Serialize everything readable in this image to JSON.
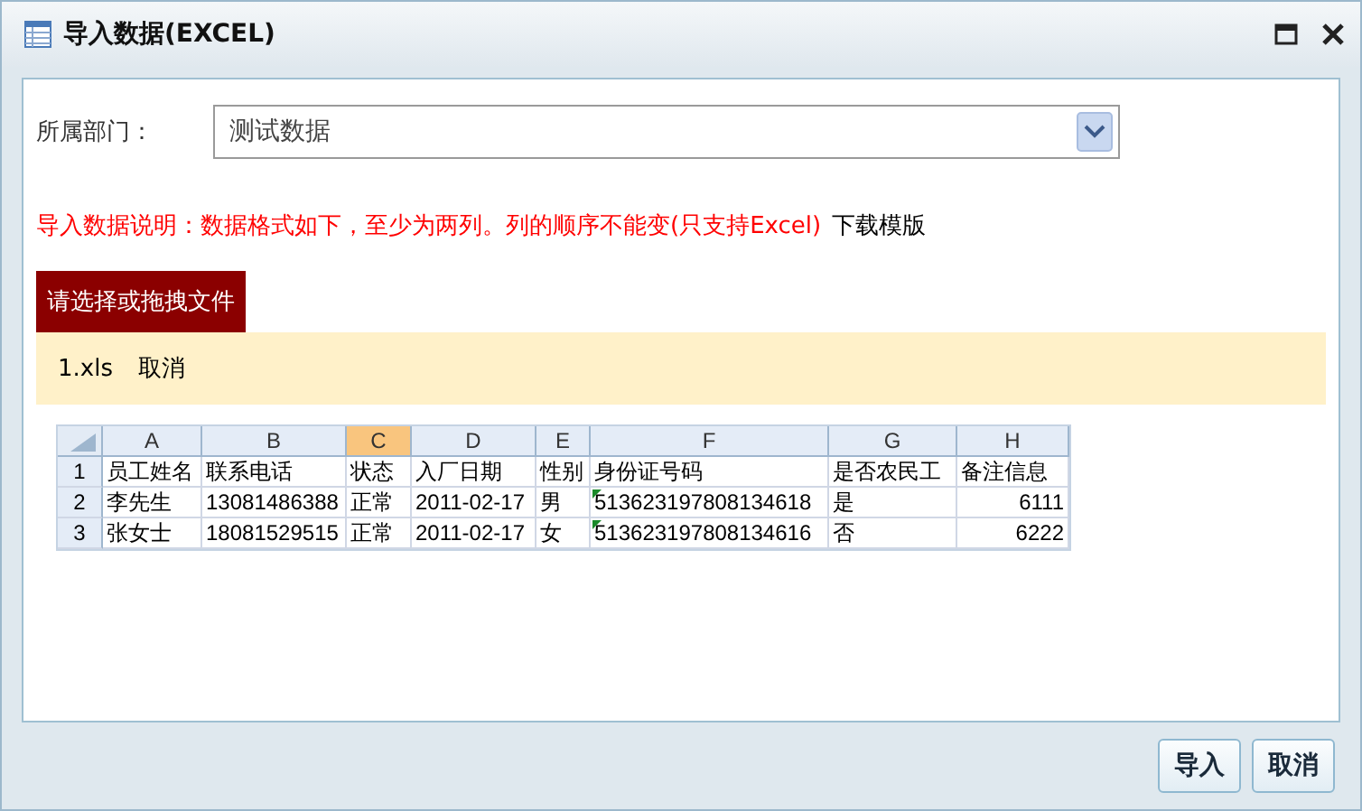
{
  "window": {
    "title": "导入数据(EXCEL)"
  },
  "department": {
    "label": "所属部门：",
    "value": "测试数据"
  },
  "notice": {
    "text": "导入数据说明：数据格式如下，至少为两列。列的顺序不能变(只支持Excel)",
    "link": "下载模版"
  },
  "upload": {
    "button": "请选择或拖拽文件",
    "file": {
      "name": "1.xls",
      "cancel": "取消"
    }
  },
  "sheet": {
    "columns": [
      {
        "letter": "A",
        "selected": false,
        "kind": "text"
      },
      {
        "letter": "B",
        "selected": false,
        "kind": "text"
      },
      {
        "letter": "C",
        "selected": true,
        "kind": "text"
      },
      {
        "letter": "D",
        "selected": false,
        "kind": "text"
      },
      {
        "letter": "E",
        "selected": false,
        "kind": "text"
      },
      {
        "letter": "F",
        "selected": false,
        "kind": "flagged"
      },
      {
        "letter": "G",
        "selected": false,
        "kind": "text"
      },
      {
        "letter": "H",
        "selected": false,
        "kind": "number"
      }
    ],
    "header": {
      "number": "1",
      "cells": [
        "员工姓名",
        "联系电话",
        "状态",
        "入厂日期",
        "性别",
        "身份证号码",
        "是否农民工",
        "备注信息"
      ]
    },
    "rows": [
      {
        "number": "2",
        "cells": [
          "李先生",
          "13081486388",
          "正常",
          "2011-02-17",
          "男",
          "513623197808134618",
          "是",
          "6111"
        ]
      },
      {
        "number": "3",
        "cells": [
          "张女士",
          "18081529515",
          "正常",
          "2011-02-17",
          "女",
          "513623197808134616",
          "否",
          "6222"
        ]
      }
    ]
  },
  "buttons": [
    "导入",
    "取消"
  ]
}
